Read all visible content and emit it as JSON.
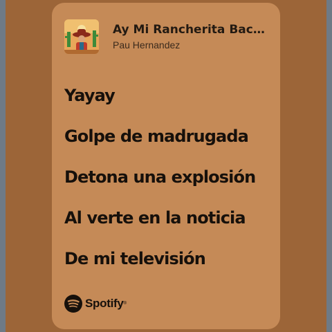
{
  "colors": {
    "background": "#9c6538",
    "card": "#c58a57",
    "text": "#16100b"
  },
  "track": {
    "title": "Ay Mi Rancherita Bach...",
    "artist": "Pau Hernandez",
    "cover_icon": "album-cover-art"
  },
  "lyrics": [
    "Yayay",
    "Golpe de madrugada",
    "Detona una explosión",
    "Al verte en la noticia",
    "De mi televisión"
  ],
  "brand": {
    "name": "Spotify",
    "icon": "spotify-icon"
  }
}
